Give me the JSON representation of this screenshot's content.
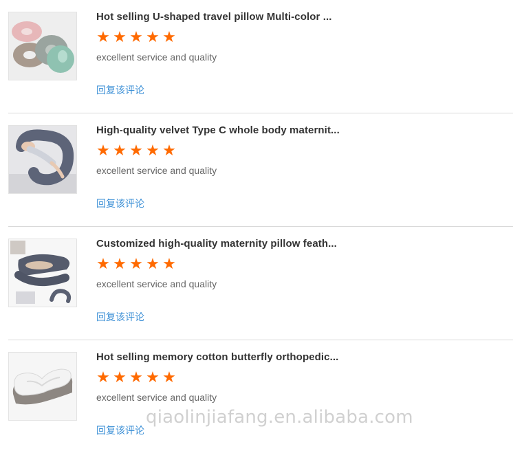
{
  "reviews": [
    {
      "product_image": "u-shaped-travel-pillow",
      "title": "Hot selling U-shaped travel pillow Multi-color ...",
      "rating": 5,
      "comment": "excellent service and quality",
      "reply_label": "回复该评论"
    },
    {
      "product_image": "c-shaped-body-pillow",
      "title": "High-quality velvet Type C whole body maternit...",
      "rating": 5,
      "comment": "excellent service and quality",
      "reply_label": "回复该评论"
    },
    {
      "product_image": "u-shaped-maternity-pillow",
      "title": "Customized high-quality maternity pillow feath...",
      "rating": 5,
      "comment": "excellent service and quality",
      "reply_label": "回复该评论"
    },
    {
      "product_image": "butterfly-memory-pillow",
      "title": "Hot selling memory cotton butterfly orthopedic...",
      "rating": 5,
      "comment": "excellent service and quality",
      "reply_label": "回复该评论"
    }
  ],
  "star_glyph": "★",
  "colors": {
    "star": "#ff6a00",
    "reply_link": "#3b8fd6",
    "title": "#333333",
    "comment": "#666666"
  },
  "watermark": "qiaolinjiafang.en.alibaba.com"
}
